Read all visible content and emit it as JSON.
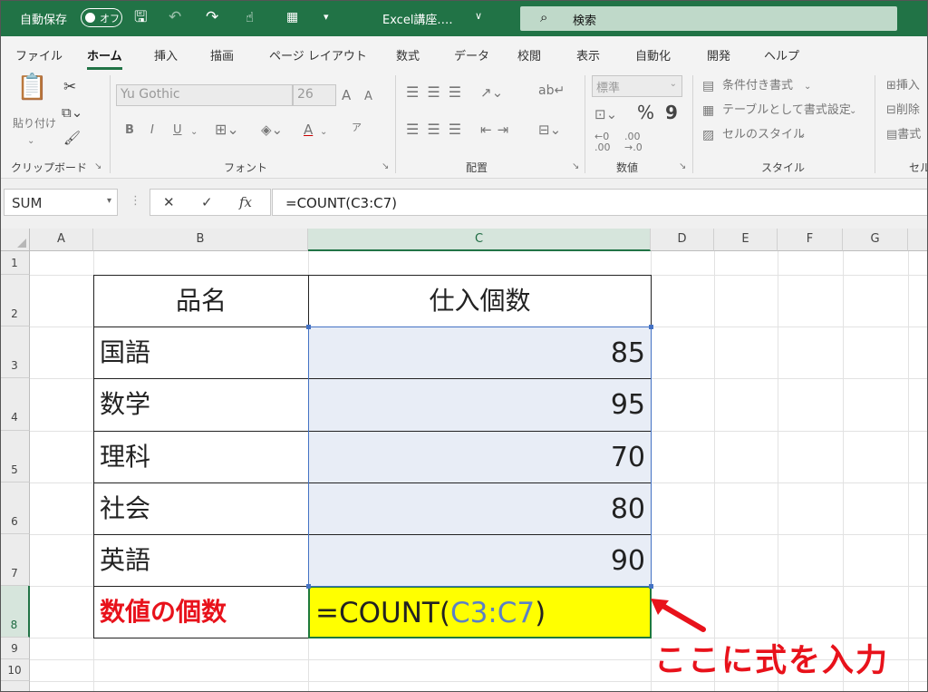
{
  "titlebar": {
    "autosave_label": "自動保存",
    "autosave_state": "オフ",
    "filename": "Excel講座.…",
    "caret": "∨",
    "search_label": "検索",
    "icons": [
      "save-icon",
      "undo-icon",
      "redo-icon",
      "touch-mode-icon",
      "form-icon",
      "customize-icon"
    ]
  },
  "tabs": [
    "ファイル",
    "ホーム",
    "挿入",
    "描画",
    "ページ レイアウト",
    "数式",
    "データ",
    "校閲",
    "表示",
    "自動化",
    "開発",
    "ヘルプ"
  ],
  "ribbon": {
    "clipboard": {
      "paste": "貼り付け",
      "label": "クリップボード"
    },
    "font": {
      "name": "Yu Gothic",
      "size": "26",
      "grow": "A",
      "shrink": "A",
      "bold": "B",
      "italic": "I",
      "underline": "U",
      "phonetic": "ア",
      "label": "フォント"
    },
    "alignment": {
      "label": "配置"
    },
    "number": {
      "format": "標準",
      "percent": "%",
      "comma": "9",
      "label": "数値"
    },
    "styles": {
      "conditional": "条件付き書式",
      "table": "テーブルとして書式設定",
      "cell": "セルのスタイル",
      "label": "スタイル"
    },
    "cells": {
      "insert": "挿入",
      "delete": "削除",
      "format": "書式",
      "label": "セル"
    }
  },
  "formula_bar": {
    "name_box": "SUM",
    "cancel": "✕",
    "enter": "✓",
    "fx": "fx",
    "formula": "=COUNT(C3:C7)"
  },
  "columns": [
    "A",
    "B",
    "C",
    "D",
    "E",
    "F",
    "G"
  ],
  "rows": [
    "1",
    "2",
    "3",
    "4",
    "5",
    "6",
    "7",
    "8",
    "9",
    "10"
  ],
  "table": {
    "header_name": "品名",
    "header_qty": "仕入個数",
    "rows": [
      {
        "name": "国語",
        "qty": "85"
      },
      {
        "name": "数学",
        "qty": "95"
      },
      {
        "name": "理科",
        "qty": "70"
      },
      {
        "name": "社会",
        "qty": "80"
      },
      {
        "name": "英語",
        "qty": "90"
      }
    ],
    "count_label": "数値の個数",
    "formula_prefix": "=COUNT(",
    "formula_ref": "C3:C7",
    "formula_suffix": ")"
  },
  "annotation": "ここに式を入力",
  "colors": {
    "excel_green": "#217346",
    "highlight": "#ffff00",
    "annotation_red": "#e8121b",
    "range_blue": "#4472c4"
  }
}
